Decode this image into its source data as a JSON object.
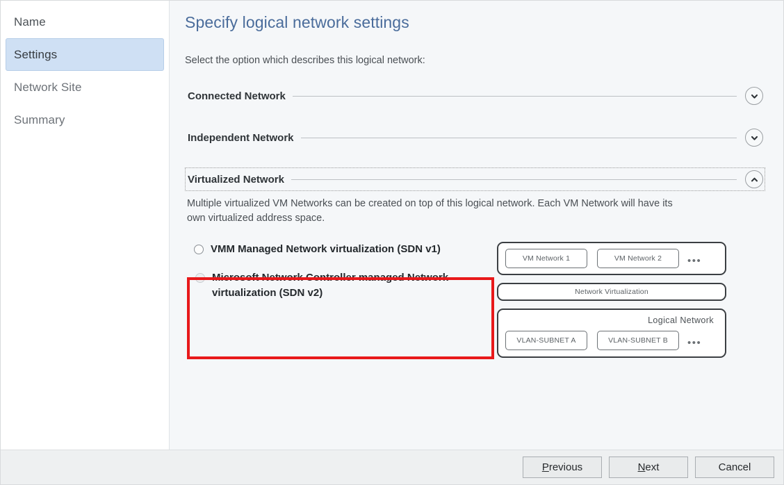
{
  "sidebar": {
    "items": [
      {
        "label": "Name",
        "active": false
      },
      {
        "label": "Settings",
        "active": true
      },
      {
        "label": "Network Site",
        "active": false
      },
      {
        "label": "Summary",
        "active": false
      }
    ]
  },
  "content": {
    "title": "Specify logical network settings",
    "subtitle": "Select the option which describes this logical network:",
    "groups": [
      {
        "title": "Connected Network",
        "state": "collapsed",
        "chevron": "chevron-down-icon"
      },
      {
        "title": "Independent Network",
        "state": "collapsed",
        "chevron": "chevron-down-icon"
      },
      {
        "title": "Virtualized Network",
        "state": "expanded",
        "chevron": "chevron-up-icon"
      }
    ],
    "virtualized": {
      "description": "Multiple virtualized VM Networks can be created on top of this logical network. Each VM Network will have its own virtualized address space.",
      "options": [
        {
          "label": "VMM Managed Network virtualization (SDN v1)",
          "selected": false,
          "disabled": false
        },
        {
          "label": "Microsoft Network Controller managed Network virtualization (SDN v2)",
          "selected": false,
          "disabled": true
        }
      ]
    },
    "diagram": {
      "vm_networks": [
        "VM Network 1",
        "VM Network 2"
      ],
      "vm_networks_ellipsis": "•••",
      "network_virtualization_label": "Network Virtualization",
      "logical_network_label": "Logical  Network",
      "vlan_subnets": [
        "VLAN-SUBNET A",
        "VLAN-SUBNET B"
      ],
      "vlan_subnets_ellipsis": "•••"
    },
    "annotation": {
      "color": "#e8191b"
    }
  },
  "footer": {
    "previous_accel": "P",
    "previous_rest": "revious",
    "next_accel": "N",
    "next_rest": "ext",
    "cancel_label": "Cancel"
  },
  "colors": {
    "accent_title": "#4a6c9b",
    "nav_active_bg": "#cfe0f4",
    "annotation": "#e8191b"
  }
}
